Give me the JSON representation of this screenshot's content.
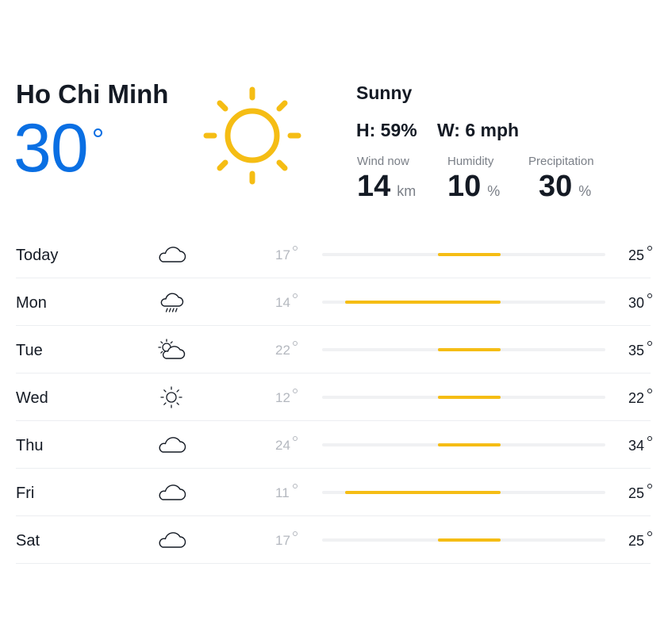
{
  "colors": {
    "accent": "#0a6fe3",
    "sun": "#f5bd14",
    "text": "#141a24",
    "muted": "#7a7f87",
    "track": "#f0f1f3"
  },
  "current": {
    "city": "Ho Chi Minh",
    "temperature": "30",
    "icon": "sun-icon",
    "condition": "Sunny",
    "humidity_line": "H: 59%",
    "wind_line": "W: 6 mph",
    "stats": [
      {
        "label": "Wind now",
        "value": "14",
        "unit": "km"
      },
      {
        "label": "Humidity",
        "value": "10",
        "unit": "%"
      },
      {
        "label": "Precipitation",
        "value": "30",
        "unit": "%"
      }
    ]
  },
  "forecast": [
    {
      "day": "Today",
      "icon": "cloud-icon",
      "low": "17",
      "high": "25",
      "range_start": 0.41,
      "range_end": 0.63
    },
    {
      "day": "Mon",
      "icon": "rain-cloud-icon",
      "low": "14",
      "high": "30",
      "range_start": 0.08,
      "range_end": 0.63
    },
    {
      "day": "Tue",
      "icon": "partly-cloudy-icon",
      "low": "22",
      "high": "35",
      "range_start": 0.41,
      "range_end": 0.63
    },
    {
      "day": "Wed",
      "icon": "sun-icon",
      "low": "12",
      "high": "22",
      "range_start": 0.41,
      "range_end": 0.63
    },
    {
      "day": "Thu",
      "icon": "cloud-icon",
      "low": "24",
      "high": "34",
      "range_start": 0.41,
      "range_end": 0.63
    },
    {
      "day": "Fri",
      "icon": "cloud-icon",
      "low": "11",
      "high": "25",
      "range_start": 0.08,
      "range_end": 0.63
    },
    {
      "day": "Sat",
      "icon": "cloud-icon",
      "low": "17",
      "high": "25",
      "range_start": 0.41,
      "range_end": 0.63
    }
  ]
}
